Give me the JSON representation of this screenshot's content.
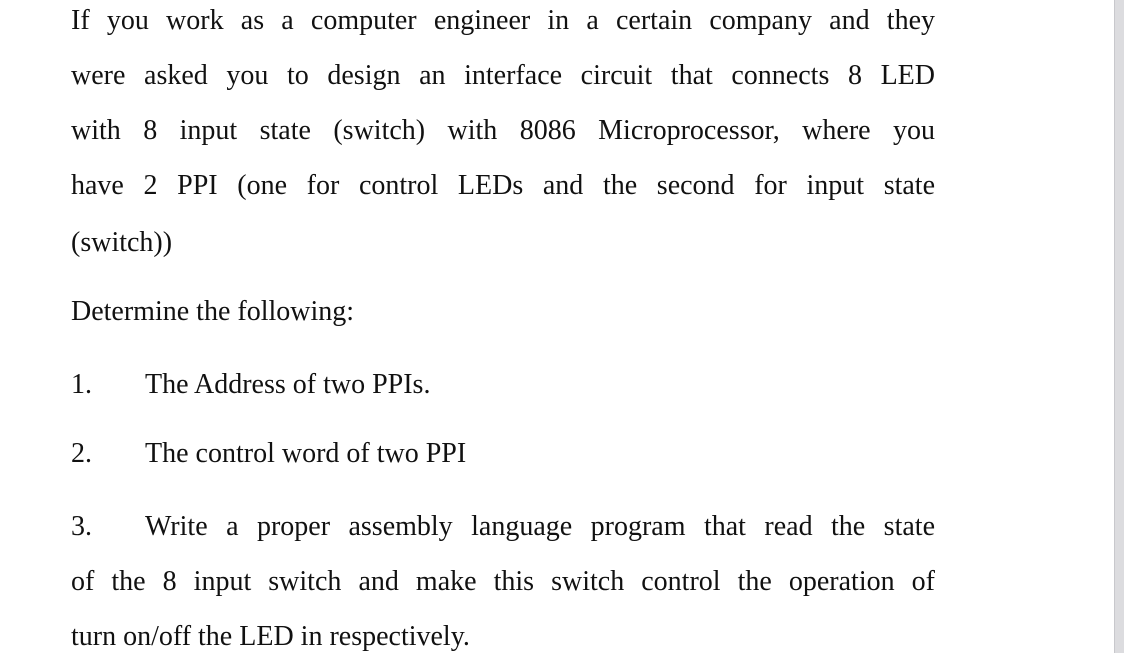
{
  "document": {
    "intro_lines": [
      "If you work as a computer engineer in a certain company and they",
      "were asked you to design an interface circuit that connects 8 LED",
      "with 8 input state (switch) with 8086 Microprocessor, where you",
      "have 2 PPI (one for control LEDs and the second for input state",
      "(switch))"
    ],
    "prompt": "Determine the following:",
    "items": [
      {
        "number": "1.",
        "text": "The Address of two PPIs."
      },
      {
        "number": "2.",
        "text": "The control word of two PPI"
      },
      {
        "number": "3.",
        "text": "Write a proper assembly language program that read the state"
      }
    ],
    "item3_continuation": [
      "of the 8 input switch and make this switch control the operation of",
      "turn on/off the LED in respectively."
    ]
  }
}
